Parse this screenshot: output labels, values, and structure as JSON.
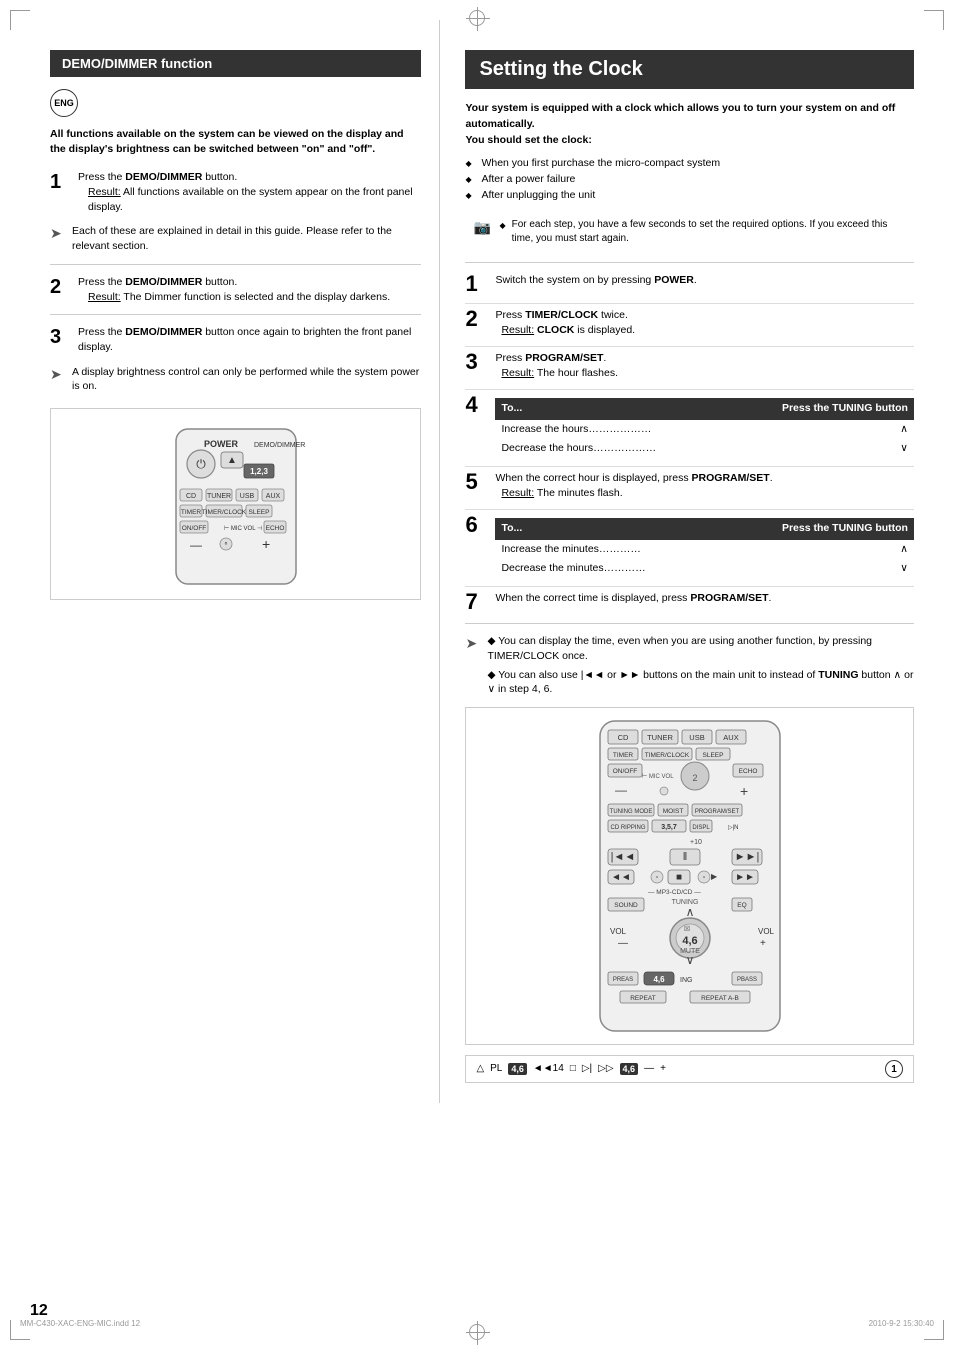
{
  "page": {
    "number": "12",
    "footer_left": "MM-C430-XAC-ENG-MIC.indd   12",
    "footer_right": "2010-9-2   15:30:40"
  },
  "left": {
    "section_title": "DEMO/DIMMER function",
    "lang_badge": "ENG",
    "intro": "All functions available on the system can be viewed on the display and the display's brightness can be switched between \"on\" and \"off\".",
    "steps": [
      {
        "number": "1",
        "main": "Press the DEMO/DIMMER button.",
        "result_label": "Result:",
        "result_text": " All functions available on the system appear on the front panel display."
      },
      {
        "number": "2",
        "main": "Press the DEMO/DIMMER button.",
        "result_label": "Result:",
        "result_text": " The Dimmer function is selected and the display darkens."
      },
      {
        "number": "3",
        "main": "Press the DEMO/DIMMER button once again to brighten the front panel display."
      }
    ],
    "notes": [
      "Each of these are explained in detail in this guide. Please refer to the relevant section.",
      "A display brightness control can only be performed while the system power is on."
    ],
    "remote_label_top": "POWER",
    "remote_label_demo": "DEMO/DIMMER",
    "remote_badge": "1,2,3"
  },
  "right": {
    "title": "Setting the Clock",
    "intro_bold": "Your system is equipped with a clock which allows you to turn your system on and off automatically.",
    "should_set": "You should set the clock:",
    "bullet_items": [
      "When you first purchase the micro-compact system",
      "After a power failure",
      "After unplugging the unit"
    ],
    "tip_text": "For each step, you have a few seconds to set the required options. If you exceed this time, you must start again.",
    "steps": [
      {
        "number": "1",
        "main": "Switch the system on by pressing POWER."
      },
      {
        "number": "2",
        "main": "Press TIMER/CLOCK twice.",
        "result_label": "Result:",
        "result_text": " CLOCK is displayed."
      },
      {
        "number": "3",
        "main": "Press PROGRAM/SET.",
        "result_label": "Result:",
        "result_text": " The hour flashes."
      },
      {
        "number": "4",
        "table_header_left": "To...",
        "table_header_right": "Press the TUNING button",
        "table_rows": [
          {
            "left": "Increase the hours………………",
            "arrow": "∧"
          },
          {
            "left": "Decrease the hours………………",
            "arrow": "∨"
          }
        ]
      },
      {
        "number": "5",
        "main": "When the correct hour is displayed, press PROGRAM/SET.",
        "result_label": "Result:",
        "result_text": " The minutes flash."
      },
      {
        "number": "6",
        "table_header_left": "To...",
        "table_header_right": "Press the TUNING button",
        "table_rows": [
          {
            "left": "Increase the minutes…………",
            "arrow": "∧"
          },
          {
            "left": "Decrease the minutes…………",
            "arrow": "∨"
          }
        ]
      },
      {
        "number": "7",
        "main": "When the correct time is displayed, press PROGRAM/SET."
      }
    ],
    "bottom_notes": [
      "You can display the time, even when you are using another function, by pressing TIMER/CLOCK once.",
      "You can also use |◄◄ or ►►| buttons on the main unit to instead of TUNING button ∧ or ∨ in step 4, 6."
    ],
    "display_items": [
      "△",
      "PL4,6◄◄14",
      "□",
      "▷|",
      "▷▷4,6",
      "—",
      "+"
    ],
    "display_badge": "1"
  }
}
